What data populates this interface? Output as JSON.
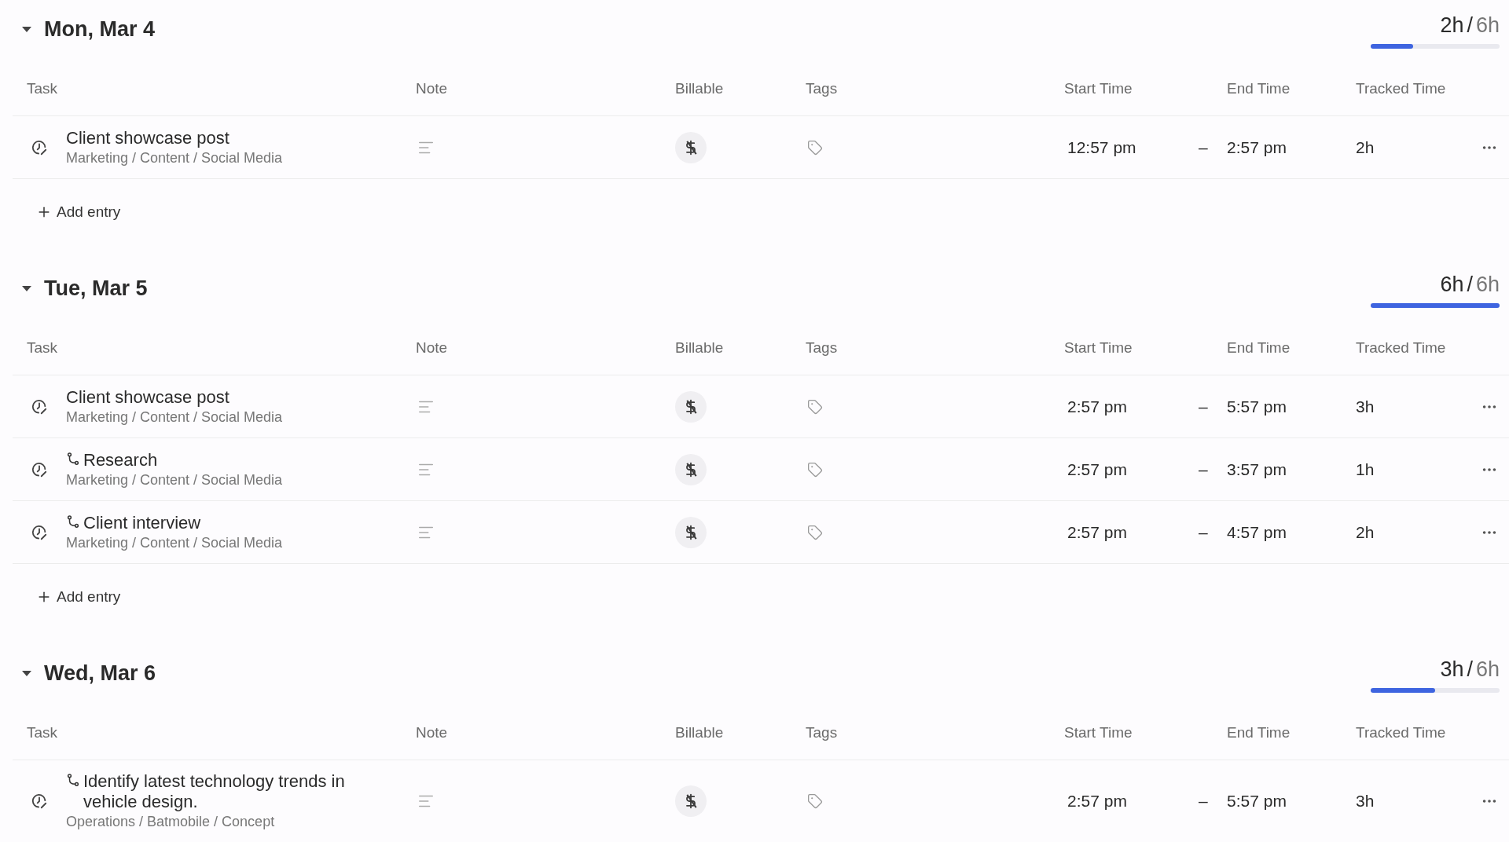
{
  "days": [
    {
      "label": "Mon, Mar 4",
      "expanded": true,
      "tracked": "2h",
      "separator": "/",
      "goal": "6h",
      "level": 0.33,
      "columns": [
        "Task",
        "Note",
        "Billable",
        "Tags",
        "Start Time",
        "End Time",
        "Tracked Time"
      ],
      "entries": [
        {
          "kind": "task",
          "title": "Client showcase post",
          "path": "Marketing / Content / Social Media",
          "billable": false,
          "start": "12:57 pm",
          "dash": "–",
          "end": "2:57 pm",
          "tracked": "2h"
        }
      ],
      "add_entry": "Add entry"
    },
    {
      "label": "Tue, Mar 5",
      "expanded": true,
      "tracked": "6h",
      "separator": "/",
      "goal": "6h",
      "level": 1,
      "columns": [
        "Task",
        "Note",
        "Billable",
        "Tags",
        "Start Time",
        "End Time",
        "Tracked Time"
      ],
      "entries": [
        {
          "kind": "task",
          "title": "Client showcase post",
          "path": "Marketing / Content / Social Media",
          "billable": false,
          "start": "2:57 pm",
          "dash": "–",
          "end": "5:57 pm",
          "tracked": "3h"
        },
        {
          "kind": "subtask",
          "title": "Research",
          "path": "Marketing / Content / Social Media",
          "billable": false,
          "start": "2:57 pm",
          "dash": "–",
          "end": "3:57 pm",
          "tracked": "1h"
        },
        {
          "kind": "subtask",
          "title": "Client interview",
          "path": "Marketing / Content / Social Media",
          "billable": false,
          "start": "2:57 pm",
          "dash": "–",
          "end": "4:57 pm",
          "tracked": "2h"
        }
      ],
      "add_entry": "Add entry"
    },
    {
      "label": "Wed, Mar 6",
      "expanded": true,
      "tracked": "3h",
      "separator": "/",
      "goal": "6h",
      "level": 0.5,
      "columns": [
        "Task",
        "Note",
        "Billable",
        "Tags",
        "Start Time",
        "End Time",
        "Tracked Time"
      ],
      "entries": [
        {
          "kind": "subtask",
          "title": "Identify latest technology trends in vehicle design.",
          "path": "Operations / Batmobile / Concept",
          "billable": false,
          "start": "2:57 pm",
          "dash": "–",
          "end": "5:57 pm",
          "tracked": "3h"
        }
      ]
    }
  ]
}
